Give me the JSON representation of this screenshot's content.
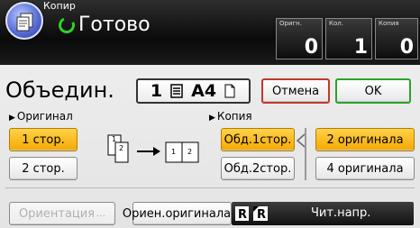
{
  "header": {
    "app_name": "Копир",
    "status": "Готово",
    "counters": [
      {
        "label": "Оригн.",
        "value": "0"
      },
      {
        "label": "Кол.",
        "value": "1"
      },
      {
        "label": "Копия",
        "value": "0"
      }
    ]
  },
  "function_title": "Объедин.",
  "paper": {
    "tray": "1",
    "size": "A4"
  },
  "actions": {
    "cancel": "Отмена",
    "ok": "OK"
  },
  "original": {
    "label": "Оригинал",
    "options": [
      {
        "label": "1 стор.",
        "selected": true
      },
      {
        "label": "2 стор.",
        "selected": false
      }
    ]
  },
  "diagram": {
    "src_pages": [
      "1",
      "2"
    ],
    "dst_pages": [
      "1",
      "2"
    ]
  },
  "copy": {
    "label": "Копия",
    "sides": [
      {
        "label": "Обд.1стор.",
        "selected": true
      },
      {
        "label": "Обд.2стор.",
        "selected": false
      }
    ],
    "count": [
      {
        "label": "2 оригинала",
        "selected": true
      },
      {
        "label": "4 оригинала",
        "selected": false
      }
    ]
  },
  "bottom": {
    "orientation": "Ориентация",
    "orig_orientation": "Ориен.оригинала",
    "read_direction": "Чит.напр."
  },
  "colors": {
    "selected": "#f5a800",
    "cancel_border": "#c0392b",
    "ok_border": "#2aa32a",
    "status_ring": "#33d02b"
  }
}
